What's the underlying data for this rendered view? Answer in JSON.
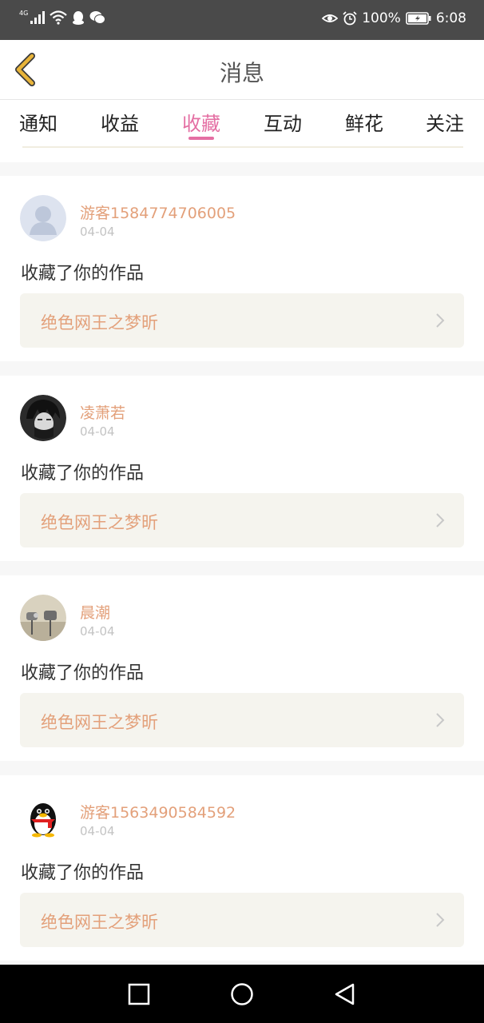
{
  "status_bar": {
    "network_type": "4G",
    "battery_percent": "100%",
    "time": "6:08",
    "left_icons": [
      "signal-icon",
      "wifi-icon",
      "qq-notification-icon",
      "wechat-notification-icon"
    ],
    "right_icons": [
      "eye-protection-icon",
      "alarm-icon",
      "battery-icon"
    ]
  },
  "header": {
    "title": "消息",
    "back_icon": "chevron-left-icon",
    "accent_color": "#e8b43a"
  },
  "tabs": [
    {
      "label": "通知",
      "active": false
    },
    {
      "label": "收益",
      "active": false
    },
    {
      "label": "收藏",
      "active": true
    },
    {
      "label": "互动",
      "active": false
    },
    {
      "label": "鲜花",
      "active": false
    },
    {
      "label": "关注",
      "active": false
    }
  ],
  "colors": {
    "active_tab": "#e46fa3",
    "username": "#e3a07a",
    "work_title": "#e3a07a",
    "date": "#c3c3c3"
  },
  "messages": [
    {
      "username": "游客1584774706005",
      "date": "04-04",
      "action": "收藏了你的作品",
      "work_title": "绝色网王之梦昕",
      "avatar": "default-user-avatar"
    },
    {
      "username": "凌萧若",
      "date": "04-04",
      "action": "收藏了你的作品",
      "work_title": "绝色网王之梦昕",
      "avatar": "anime-boy-avatar"
    },
    {
      "username": "晨潮",
      "date": "04-04",
      "action": "收藏了你的作品",
      "work_title": "绝色网王之梦昕",
      "avatar": "photo-avatar"
    },
    {
      "username": "游客1563490584592",
      "date": "04-04",
      "action": "收藏了你的作品",
      "work_title": "绝色网王之梦昕",
      "avatar": "qq-penguin-avatar"
    }
  ],
  "nav_bar": {
    "buttons": [
      "recents-square-icon",
      "home-circle-icon",
      "back-triangle-icon"
    ]
  }
}
